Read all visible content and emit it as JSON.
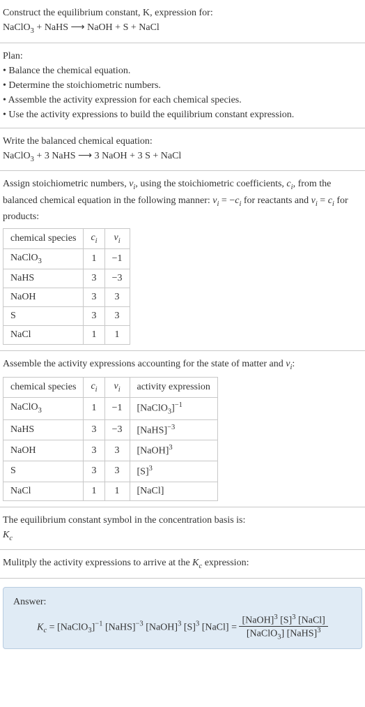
{
  "s1": {
    "line1": "Construct the equilibrium constant, K, expression for:",
    "line2_a": "NaClO",
    "line2_b": " + NaHS ",
    "line2_arrow": "⟶",
    "line2_c": " NaOH + S + NaCl"
  },
  "s2": {
    "title": "Plan:",
    "b1": "• Balance the chemical equation.",
    "b2": "• Determine the stoichiometric numbers.",
    "b3": "• Assemble the activity expression for each chemical species.",
    "b4": "• Use the activity expressions to build the equilibrium constant expression."
  },
  "s3": {
    "line1": "Write the balanced chemical equation:",
    "eq_a": "NaClO",
    "eq_b": " + 3 NaHS ",
    "arrow": "⟶",
    "eq_c": " 3 NaOH + 3 S + NaCl"
  },
  "s4": {
    "line1a": "Assign stoichiometric numbers, ",
    "nu": "ν",
    "i": "i",
    "line1b": ", using the stoichiometric coefficients, ",
    "c": "c",
    "line1c": ", from the balanced chemical equation in the following manner: ",
    "eq1a": " = −",
    "eq1b": " for reactants and ",
    "eq2a": " = ",
    "eq2b": " for products:",
    "h1": "chemical species",
    "h2": "c",
    "h3": "ν",
    "r1c1": "NaClO",
    "r1c2": "1",
    "r1c3": "−1",
    "r2c1": "NaHS",
    "r2c2": "3",
    "r2c3": "−3",
    "r3c1": "NaOH",
    "r3c2": "3",
    "r3c3": "3",
    "r4c1": "S",
    "r4c2": "3",
    "r4c3": "3",
    "r5c1": "NaCl",
    "r5c2": "1",
    "r5c3": "1"
  },
  "s5": {
    "line1": "Assemble the activity expressions accounting for the state of matter and ",
    "nu": "ν",
    "i": "i",
    "colon": ":",
    "h1": "chemical species",
    "h2": "c",
    "h3": "ν",
    "h4": "activity expression",
    "r1c1": "NaClO",
    "r1c2": "1",
    "r1c3": "−1",
    "r1c4a": "[NaClO",
    "r1c4b": "]",
    "r1c4exp": "−1",
    "r2c1": "NaHS",
    "r2c2": "3",
    "r2c3": "−3",
    "r2c4a": "[NaHS]",
    "r2c4exp": "−3",
    "r3c1": "NaOH",
    "r3c2": "3",
    "r3c3": "3",
    "r3c4a": "[NaOH]",
    "r3c4exp": "3",
    "r4c1": "S",
    "r4c2": "3",
    "r4c3": "3",
    "r4c4a": "[S]",
    "r4c4exp": "3",
    "r5c1": "NaCl",
    "r5c2": "1",
    "r5c3": "1",
    "r5c4a": "[NaCl]"
  },
  "s6": {
    "line1": "The equilibrium constant symbol in the concentration basis is:",
    "K": "K",
    "csub": "c"
  },
  "s7": {
    "line1": "Mulitply the activity expressions to arrive at the ",
    "K": "K",
    "csub": "c",
    "line1b": " expression:"
  },
  "ans": {
    "label": "Answer:",
    "K": "K",
    "csub": "c",
    "eq": " = [NaClO",
    "three": "3",
    "br": "]",
    "neg1": "−1",
    "sp1": " [NaHS]",
    "neg3": "−3",
    "sp2": " [NaOH]",
    "p3": "3",
    "sp3": " [S]",
    "sp4": " [NaCl] = ",
    "num1": "[NaOH]",
    "num2": " [S]",
    "num3": " [NaCl]",
    "den1": "[NaClO",
    "den2": "] [NaHS]"
  }
}
